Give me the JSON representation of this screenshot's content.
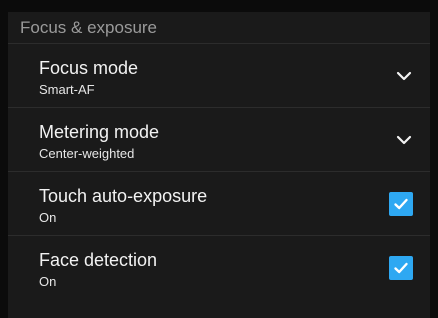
{
  "section": {
    "title": "Focus & exposure"
  },
  "settings": [
    {
      "title": "Focus mode",
      "value": "Smart-AF",
      "control": "chevron-down-icon"
    },
    {
      "title": "Metering mode",
      "value": "Center-weighted",
      "control": "chevron-down-icon"
    },
    {
      "title": "Touch auto-exposure",
      "value": "On",
      "control": "checkbox",
      "checked": true
    },
    {
      "title": "Face detection",
      "value": "On",
      "control": "checkbox",
      "checked": true
    }
  ],
  "colors": {
    "background": "#1a1a1a",
    "checkbox_accent": "#2ea8f2",
    "divider": "#2c2c2c",
    "header_text": "#9a9a9a"
  }
}
